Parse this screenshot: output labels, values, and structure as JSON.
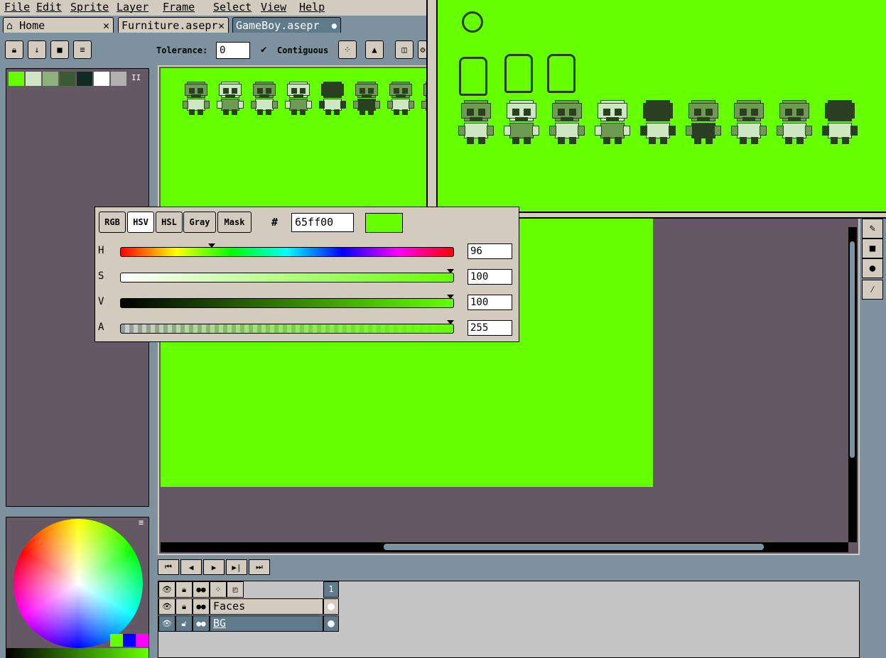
{
  "menu": [
    "File",
    "Edit",
    "Sprite",
    "Layer",
    "Frame",
    "Select",
    "View",
    "Help"
  ],
  "tabs": {
    "home": "Home",
    "furniture": "Furniture.asepr",
    "gameboy": "GameBoy.asepr",
    "close_glyph": "✕"
  },
  "toolbar": {
    "tolerance_label": "Tolerance:",
    "tolerance_value": "0",
    "contiguous_label": "Contiguous"
  },
  "palette": {
    "swatches": [
      "#65ff00",
      "#cde8c0",
      "#8eb07a",
      "#3b5a33",
      "#132a24",
      "#ffffff",
      "#b0b0b0"
    ],
    "menu_glyph": "II"
  },
  "color_picker": {
    "modes": [
      "RGB",
      "HSV",
      "HSL",
      "Gray",
      "Mask"
    ],
    "active_mode": "HSV",
    "hash": "#",
    "hex": "65ff00",
    "current_color": "#65ff00",
    "sliders": [
      {
        "label": "H",
        "value": "96",
        "level": 0.27
      },
      {
        "label": "S",
        "value": "100",
        "level": 1.0
      },
      {
        "label": "V",
        "value": "100",
        "level": 1.0
      },
      {
        "label": "A",
        "value": "255",
        "level": 1.0
      }
    ]
  },
  "timeline": {
    "frame_number": "1",
    "layers": [
      "Faces",
      "BG"
    ]
  },
  "colors": {
    "sprite_bg": "#65ff00",
    "dark": "#2b3f22",
    "mid": "#6e9a52",
    "light": "#cde8c0"
  }
}
